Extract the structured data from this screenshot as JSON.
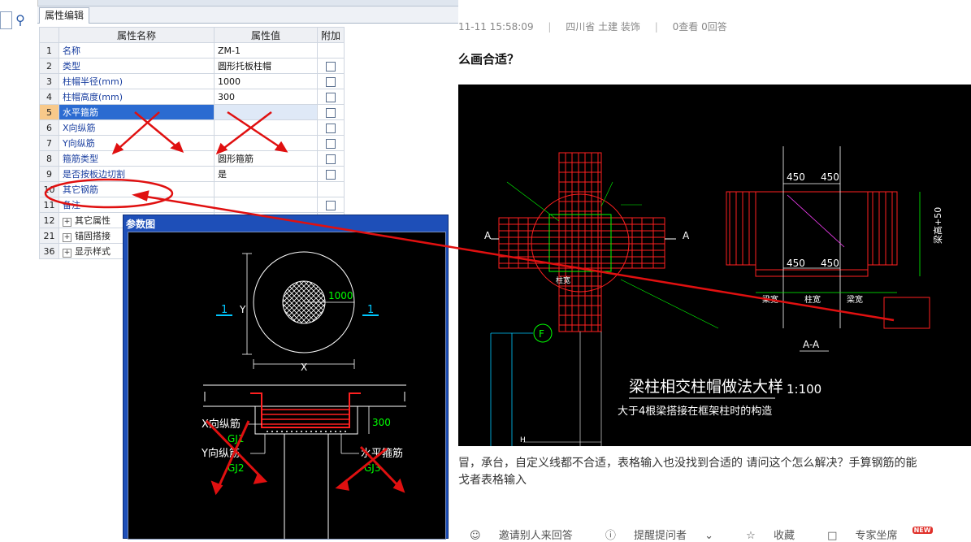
{
  "app": {
    "panel_tab": "属性编辑",
    "columns": {
      "name": "属性名称",
      "value": "属性值",
      "extra": "附加"
    },
    "rows": [
      {
        "num": "1",
        "name": "名称",
        "value": "ZM-1",
        "check": false
      },
      {
        "num": "2",
        "name": "类型",
        "value": "圆形托板柱帽",
        "check": true
      },
      {
        "num": "3",
        "name": "柱帽半径(mm)",
        "value": "1000",
        "check": true
      },
      {
        "num": "4",
        "name": "柱帽高度(mm)",
        "value": "300",
        "check": true
      },
      {
        "num": "5",
        "name": "水平箍筋",
        "value": "",
        "check": true
      },
      {
        "num": "6",
        "name": "X向纵筋",
        "value": "",
        "check": true
      },
      {
        "num": "7",
        "name": "Y向纵筋",
        "value": "",
        "check": true
      },
      {
        "num": "8",
        "name": "箍筋类型",
        "value": "圆形箍筋",
        "check": true
      },
      {
        "num": "9",
        "name": "是否按板边切割",
        "value": "是",
        "check": true
      },
      {
        "num": "10",
        "name": "其它钢筋",
        "value": "",
        "check": false
      },
      {
        "num": "11",
        "name": "备注",
        "value": "",
        "check": true
      }
    ],
    "groups": [
      {
        "num": "12",
        "name": "其它属性"
      },
      {
        "num": "21",
        "name": "锚固搭接"
      },
      {
        "num": "36",
        "name": "显示样式"
      }
    ],
    "param_window_title": "参数图",
    "param_drawing": {
      "dim_value": "1000",
      "section_mark": "1",
      "x_label": "X",
      "y_label": "Y",
      "height_label": "300",
      "x_bar": "X向纵筋",
      "gj1": "GJ1",
      "y_bar": "Y向纵筋",
      "gj2": "GJ2",
      "h_stirrup": "水平箍筋",
      "gj3": "GJ3"
    }
  },
  "question": {
    "meta_time": "11-11 15:58:09",
    "meta_region": "四川省  土建 装饰",
    "meta_views": "0查看  0回答",
    "separator": "|",
    "title": "么画合适？",
    "desc_line1": "冒，承台，自定义线都不合适，表格输入也没找到合适的  请问这个怎么解决？手算钢筋的能",
    "desc_line2": "戈者表格输入",
    "actions": {
      "invite": "邀请别人来回答",
      "remind": "提醒提问者",
      "favorite": "收藏",
      "expert": "专家坐席",
      "new_badge": "NEW"
    }
  },
  "cad_drawing": {
    "section_a_left": "A",
    "section_a_right": "A",
    "dim_450_a": "450",
    "dim_450_b": "450",
    "dim_450_c": "450",
    "dim_450_d": "450",
    "axis_f": "F",
    "label_column_width": "柱宽",
    "label_beam_width": "梁宽",
    "section_aa": "A-A",
    "title": "梁柱相交柱帽做法大样",
    "scale": "1:100",
    "subtitle": "大于4根梁搭接在框架柱时的构造",
    "side_dim": "梁高+50",
    "axis_h": "H"
  },
  "colors": {
    "selection": "#2b6bd1",
    "header_value": "#f8d98a",
    "annotation_red": "#e01010",
    "link_blue": "#1a3fa0"
  },
  "icons": [
    "search-icon",
    "expand-plus-icon",
    "checkbox-icon",
    "invite-icon",
    "remind-icon",
    "star-icon",
    "expert-icon"
  ]
}
